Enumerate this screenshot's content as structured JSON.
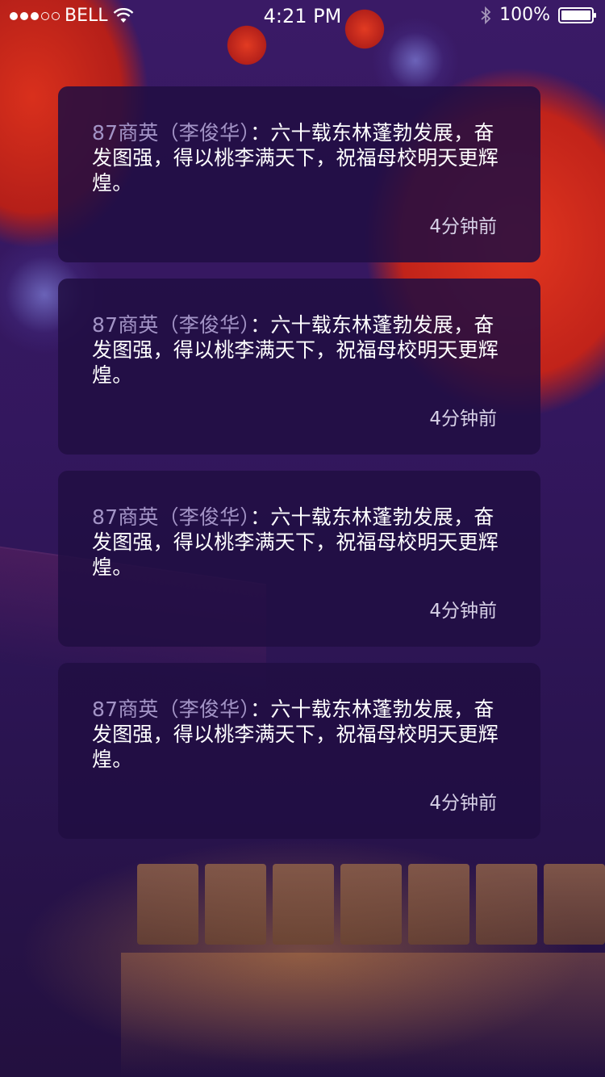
{
  "status_bar": {
    "carrier": "BELL",
    "time": "4:21 PM",
    "battery": "100%",
    "signal_bars_filled": 3,
    "signal_bars_total": 5
  },
  "posts": [
    {
      "author": "87商英（李俊华）",
      "message": "：六十载东林蓬勃发展，奋发图强，得以桃李满天下，祝福母校明天更辉煌。",
      "time": "4分钟前"
    },
    {
      "author": "87商英（李俊华）",
      "message": "：六十载东林蓬勃发展，奋发图强，得以桃李满天下，祝福母校明天更辉煌。",
      "time": "4分钟前"
    },
    {
      "author": "87商英（李俊华）",
      "message": "：六十载东林蓬勃发展，奋发图强，得以桃李满天下，祝福母校明天更辉煌。",
      "time": "4分钟前"
    },
    {
      "author": "87商英（李俊华）",
      "message": "：六十载东林蓬勃发展，奋发图强，得以桃李满天下，祝福母校明天更辉煌。",
      "time": "4分钟前"
    }
  ],
  "colors": {
    "card_background": "#210e42",
    "author_text": "#a394c6",
    "message_text": "#ffffff",
    "time_text": "#d6d0e6"
  }
}
